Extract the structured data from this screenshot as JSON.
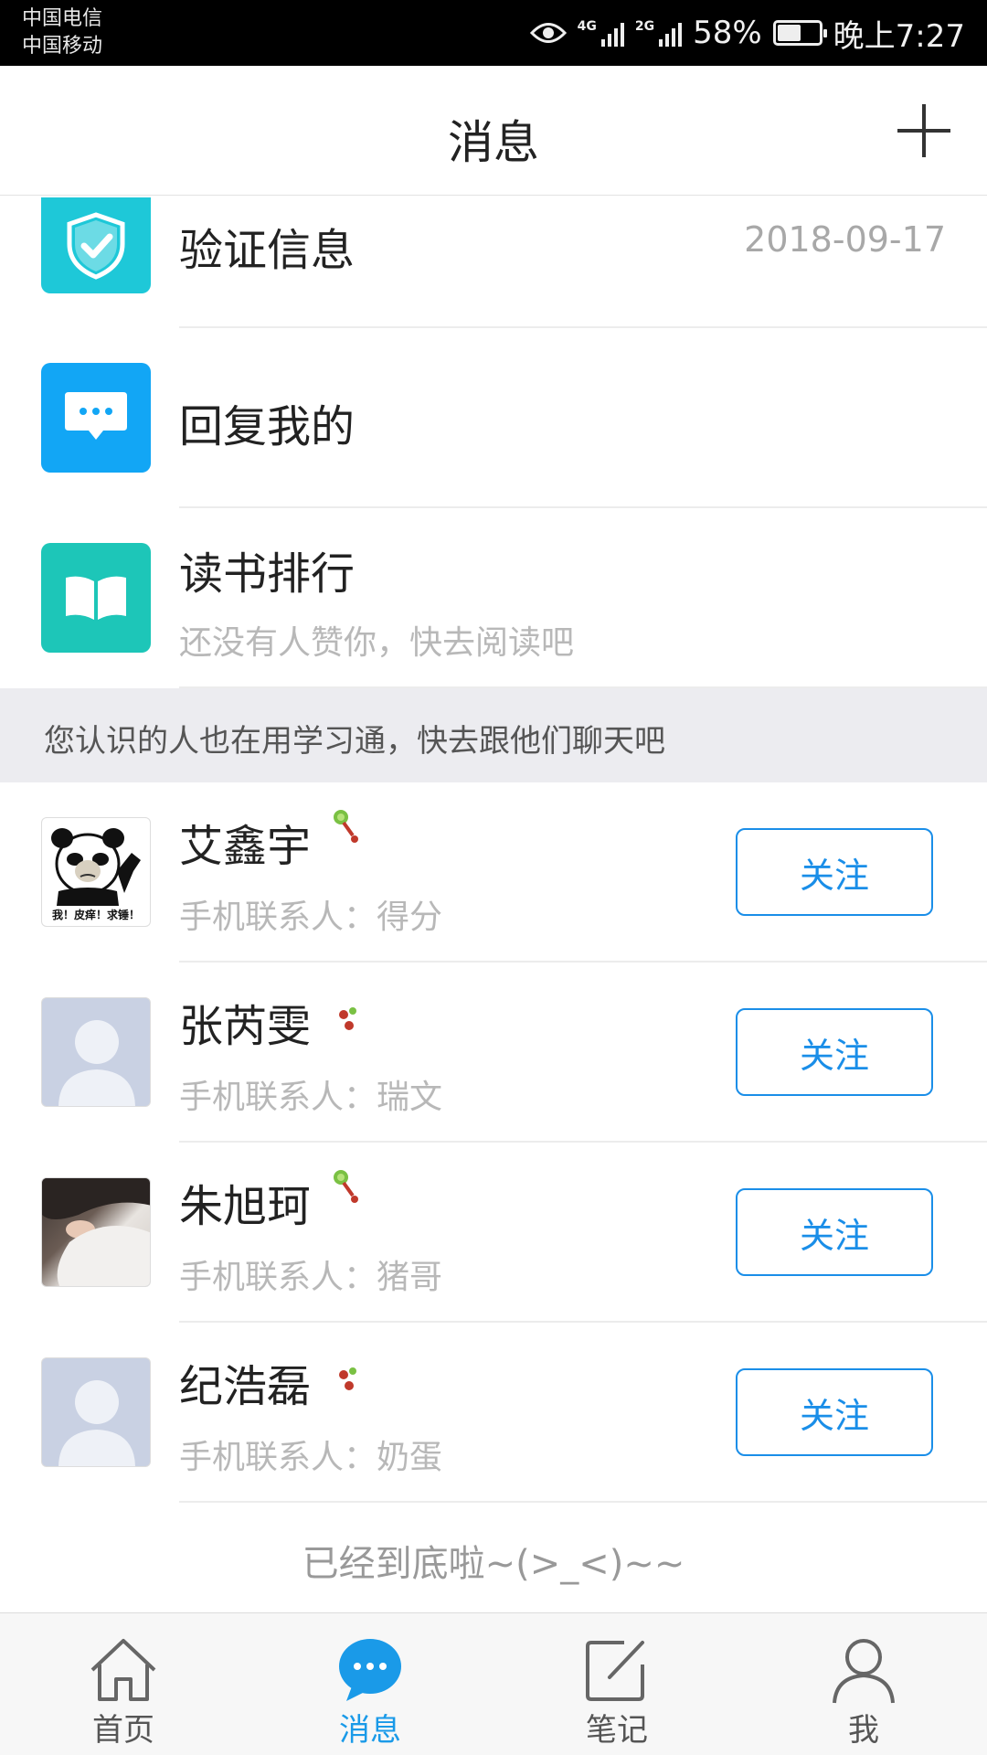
{
  "status_bar": {
    "carrier1": "中国电信",
    "carrier2": "中国移动",
    "net1": "4G",
    "net2": "2G",
    "battery": "58%",
    "battery_level": 0.58,
    "time": "晚上7:27"
  },
  "header": {
    "title": "消息",
    "add_icon": "plus-icon"
  },
  "items": [
    {
      "title": "验证信息",
      "date": "2018-09-17",
      "icon": "shield-check-icon",
      "color": "#1ec8d8"
    },
    {
      "title": "回复我的",
      "icon": "chat-bubble-icon",
      "color": "#12a6f5"
    },
    {
      "title": "读书排行",
      "subtitle": "还没有人赞你，快去阅读吧",
      "icon": "open-book-icon",
      "color": "#1dc6b8"
    }
  ],
  "banner": "您认识的人也在用学习通，快去跟他们聊天吧",
  "contacts": [
    {
      "name": "艾鑫宇",
      "sub": "手机联系人：得分",
      "button": "关注",
      "avatar": "panda-meme-avatar",
      "badge": "badge-icon"
    },
    {
      "name": "张芮雯",
      "sub": "手机联系人：瑞文",
      "button": "关注",
      "avatar": "default-avatar",
      "badge": "badge-icon"
    },
    {
      "name": "朱旭珂",
      "sub": "手机联系人：猪哥",
      "button": "关注",
      "avatar": "photo-avatar",
      "badge": "badge-icon"
    },
    {
      "name": "纪浩磊",
      "sub": "手机联系人：奶蛋",
      "button": "关注",
      "avatar": "default-avatar",
      "badge": "badge-icon"
    }
  ],
  "panda_caption": "我！皮痒！求锤！",
  "end_text": "已经到底啦~(>_<)~~",
  "nav": [
    {
      "label": "首页",
      "icon": "home-icon"
    },
    {
      "label": "消息",
      "icon": "message-icon",
      "active": true
    },
    {
      "label": "笔记",
      "icon": "note-icon"
    },
    {
      "label": "我",
      "icon": "person-icon"
    }
  ],
  "colors": {
    "accent": "#1a8ee8",
    "nav_active": "#1a9ae8"
  }
}
